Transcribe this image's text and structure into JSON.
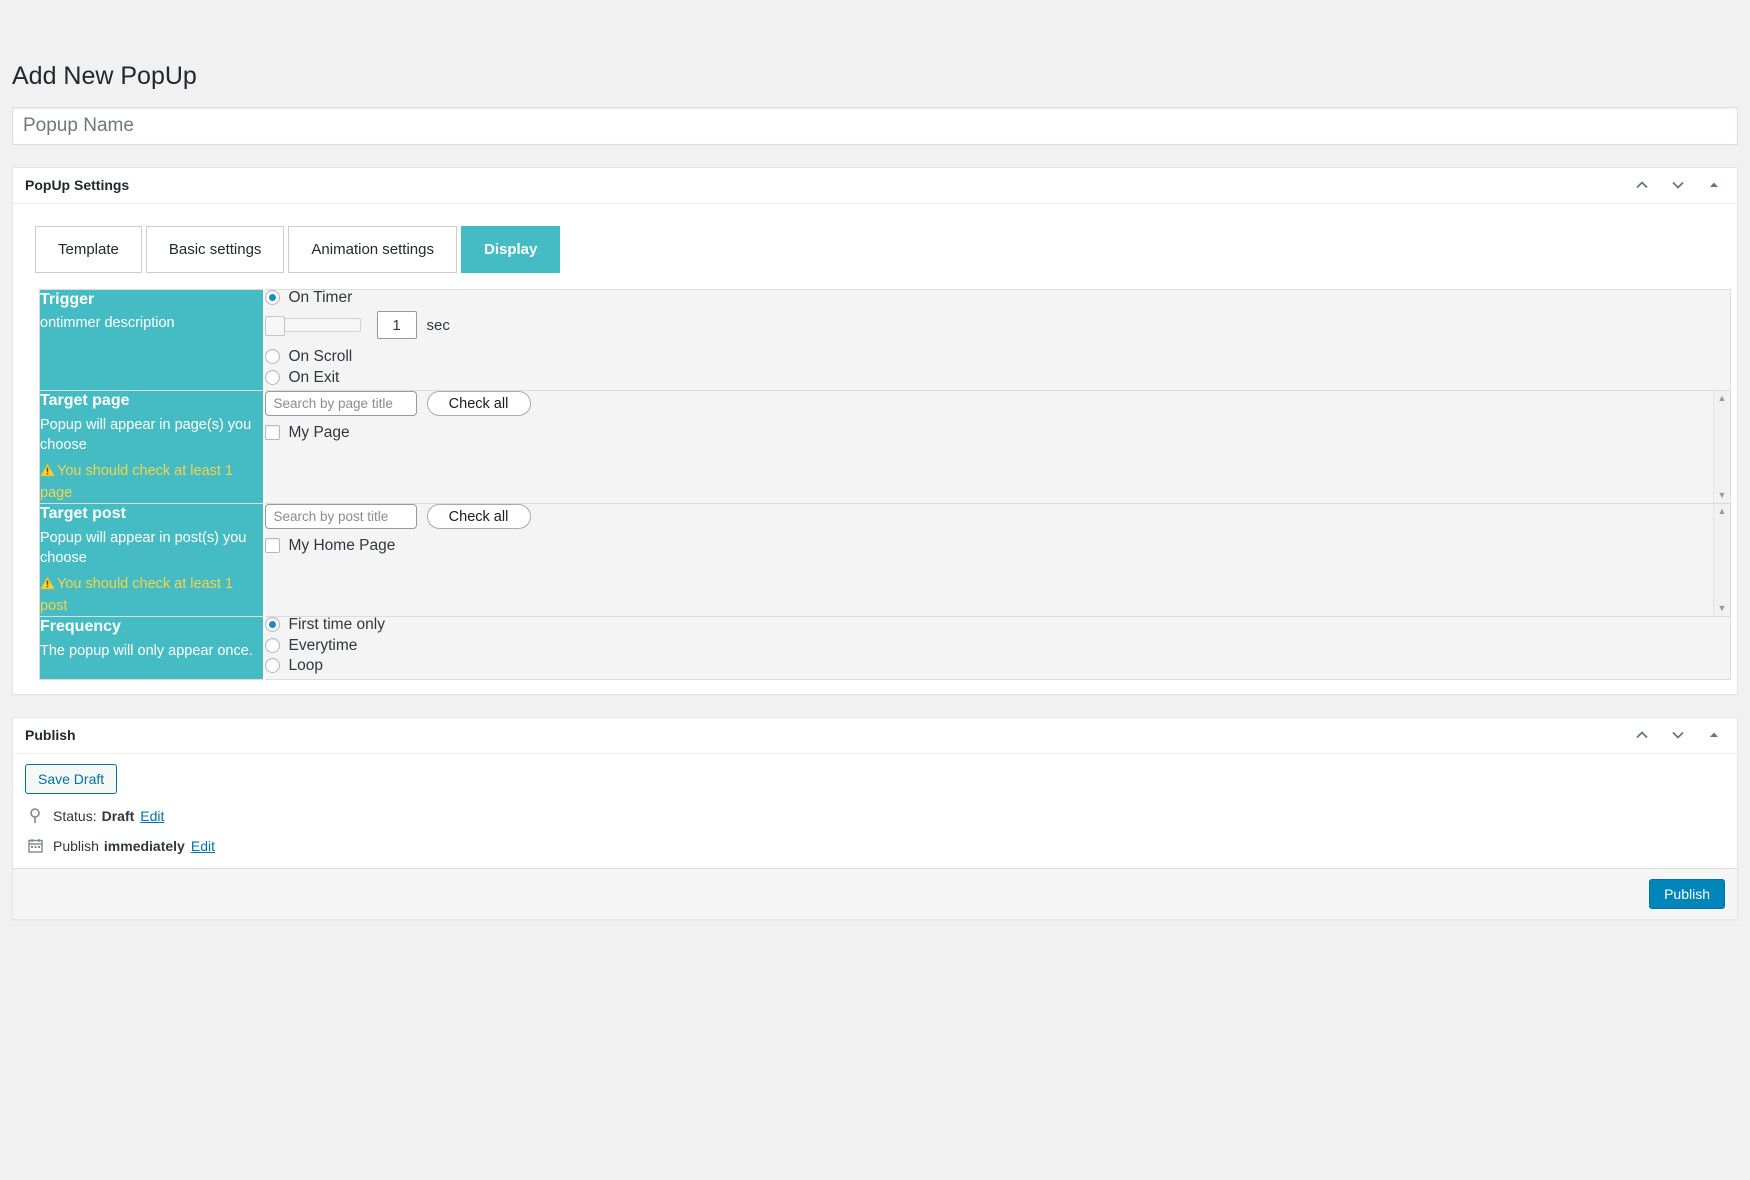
{
  "page": {
    "title": "Add New PopUp",
    "name_placeholder": "Popup Name",
    "name_value": ""
  },
  "settings_box": {
    "title": "PopUp Settings",
    "handle_up": "chevron-up",
    "handle_down": "chevron-down",
    "handle_toggle": "triangle-up"
  },
  "tabs": [
    {
      "label": "Template",
      "active": false
    },
    {
      "label": "Basic settings",
      "active": false
    },
    {
      "label": "Animation settings",
      "active": false
    },
    {
      "label": "Display",
      "active": true
    }
  ],
  "trigger": {
    "title": "Trigger",
    "desc": "ontimmer description",
    "options": [
      {
        "label": "On Timer",
        "checked": true
      },
      {
        "label": "On Scroll",
        "checked": false
      },
      {
        "label": "On Exit",
        "checked": false
      }
    ],
    "timer_value": "1",
    "timer_unit": "sec",
    "slider_position_pct": 0
  },
  "target_page": {
    "title": "Target page",
    "desc": "Popup will appear in page(s) you choose",
    "warning": "You should check at least 1 page",
    "search_placeholder": "Search by page title",
    "search_value": "",
    "check_all_label": "Check all",
    "items": [
      {
        "label": "My Page",
        "checked": false
      }
    ]
  },
  "target_post": {
    "title": "Target post",
    "desc": "Popup will appear in post(s) you choose",
    "warning": "You should check at least 1 post",
    "search_placeholder": "Search by post title",
    "search_value": "",
    "check_all_label": "Check all",
    "items": [
      {
        "label": "My Home Page",
        "checked": false
      }
    ]
  },
  "frequency": {
    "title": "Frequency",
    "desc": "The popup will only appear once.",
    "options": [
      {
        "label": "First time only",
        "checked": true
      },
      {
        "label": "Everytime",
        "checked": false
      },
      {
        "label": "Loop",
        "checked": false
      }
    ]
  },
  "publish_box": {
    "title": "Publish",
    "save_draft_label": "Save Draft",
    "status_prefix": "Status:",
    "status_value": "Draft",
    "status_edit": "Edit",
    "schedule_prefix": "Publish",
    "schedule_value": "immediately",
    "schedule_edit": "Edit",
    "publish_label": "Publish"
  },
  "colors": {
    "accent_teal": "#45bcc4",
    "warning_yellow": "#f3d44a",
    "publish_blue": "#0085ba",
    "radio_blue": "#1e8cbe"
  }
}
